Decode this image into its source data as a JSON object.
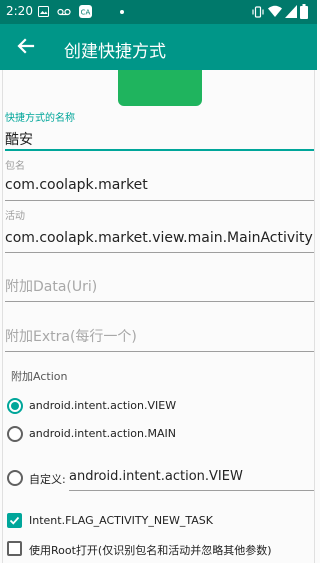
{
  "status_bar": {
    "time": "2:20",
    "notification_icons": [
      "image-icon",
      "voicemail-icon",
      "ca-icon"
    ],
    "system_icons": [
      "vibrate-icon",
      "wifi-icon",
      "signal-icon",
      "battery-icon"
    ]
  },
  "app_bar": {
    "back_icon": "arrow-left-icon",
    "title": "创建快捷方式"
  },
  "colors": {
    "status_bar": "#00796b",
    "app_bar": "#009688",
    "accent": "#00a69a",
    "app_icon": "#1fb45e"
  },
  "form": {
    "shortcut_name": {
      "label": "快捷方式的名称",
      "value": "酷安"
    },
    "package": {
      "label": "包名",
      "value": "com.coolapk.market"
    },
    "activity": {
      "label": "活动",
      "value": "com.coolapk.market.view.main.MainActivity"
    },
    "data_uri": {
      "placeholder": "附加Data(Uri)"
    },
    "extra": {
      "placeholder": "附加Extra(每行一个)"
    },
    "action_section_label": "附加Action",
    "actions": [
      {
        "label": "android.intent.action.VIEW",
        "checked": true
      },
      {
        "label": "android.intent.action.MAIN",
        "checked": false
      }
    ],
    "custom_action": {
      "label": "自定义:",
      "value": "android.intent.action.VIEW",
      "checked": false
    },
    "flags": [
      {
        "label": "Intent.FLAG_ACTIVITY_NEW_TASK",
        "checked": true
      },
      {
        "label": "使用Root打开(仅识别包名和活动并忽略其他参数)",
        "checked": false
      }
    ]
  }
}
